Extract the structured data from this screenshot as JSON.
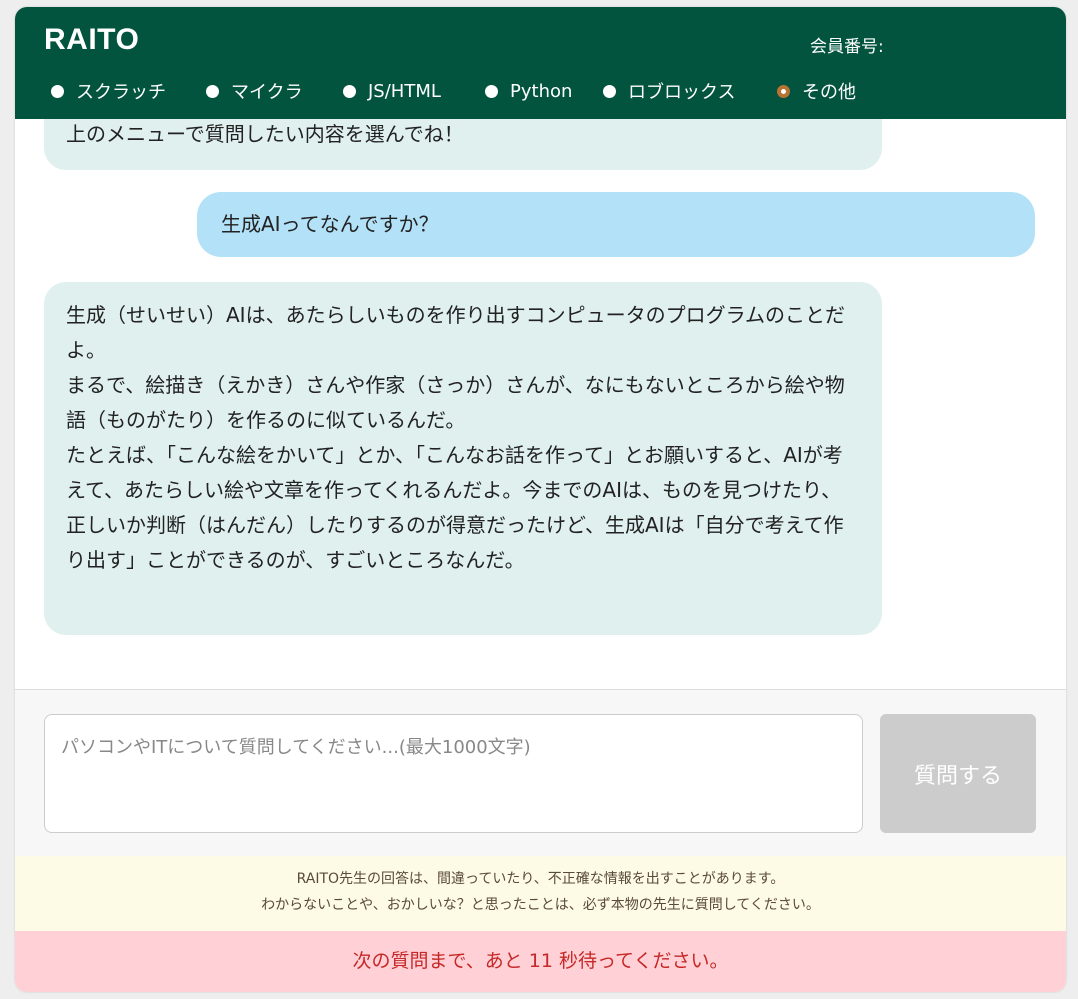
{
  "header": {
    "title": "RAITO",
    "member_label": "会員番号:"
  },
  "menu": {
    "items": [
      {
        "label": "スクラッチ",
        "checked": false
      },
      {
        "label": "マイクラ",
        "checked": false
      },
      {
        "label": "JS/HTML",
        "checked": false
      },
      {
        "label": "Python",
        "checked": false
      },
      {
        "label": "ロブロックス",
        "checked": false
      },
      {
        "label": "その他",
        "checked": true
      }
    ]
  },
  "chat": {
    "messages": [
      {
        "role": "bot",
        "lines": [
          "上のメニューで質問したい内容を選んでね！"
        ]
      },
      {
        "role": "user",
        "lines": [
          "生成AIってなんですか？"
        ]
      },
      {
        "role": "bot",
        "lines": [
          "生成（せいせい）AIは、あたらしいものを作り出すコンピュータのプログラムのことだよ。",
          "まるで、絵描き（えかき）さんや作家（さっか）さんが、なにもないところから絵や物語（ものがたり）を作るのに似ているんだ。",
          "たとえば、「こんな絵をかいて」とか、「こんなお話を作って」とお願いすると、AIが考えて、あたらしい絵や文章を作ってくれるんだよ。今までのAIは、ものを見つけたり、正しいか判断（はんだん）したりするのが得意だったけど、生成AIは「自分で考えて作り出す」ことができるのが、すごいところなんだ。"
        ]
      }
    ]
  },
  "input": {
    "placeholder": "パソコンやITについて質問してください...(最大1000文字)",
    "value": "",
    "submit_label": "質問する"
  },
  "disclaimer": {
    "line1": "RAITO先生の回答は、間違っていたり、不正確な情報を出すことがあります。",
    "line2": "わからないことや、おかしいな？と思ったことは、必ず本物の先生に質問してください。"
  },
  "wait_notice": "次の質問まで、あと 11 秒待ってください。",
  "colors": {
    "header_bg": "#03543f",
    "bot_bubble": "#dff0ee",
    "user_bubble": "#b3e1f7",
    "radio_checked": "#b87333",
    "submit_disabled": "#cccccc",
    "disclaimer_bg": "#fdfae5",
    "wait_bg": "#ffd1d6",
    "wait_text": "#c62828"
  }
}
